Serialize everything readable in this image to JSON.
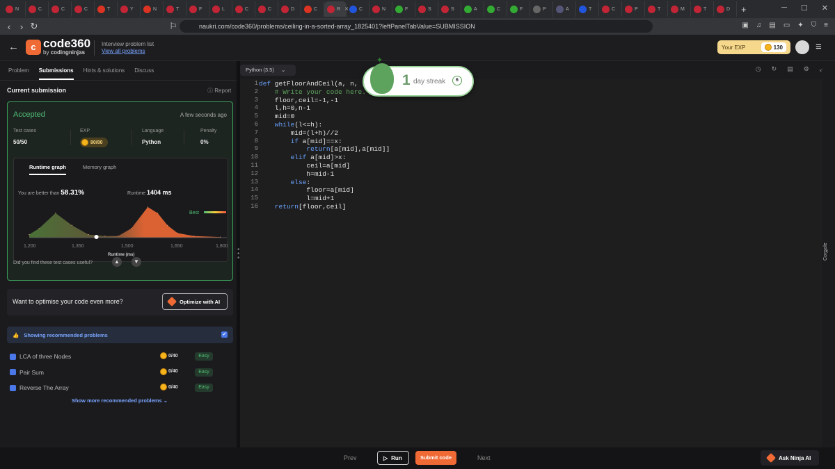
{
  "browser": {
    "tabs": [
      "N",
      "C",
      "C",
      "C",
      "T",
      "Y",
      "N",
      "T",
      "F",
      "L",
      "C",
      "C",
      "D",
      "C",
      "R",
      "C",
      "N",
      "F",
      "S",
      "S",
      "A",
      "C",
      "F",
      "P",
      "A",
      "T",
      "C",
      "P",
      "T",
      "M",
      "T",
      "D"
    ],
    "close_glyph": "✕",
    "new_tab": "+",
    "url": "naukri.com/code360/problems/ceiling-in-a-sorted-array_1825401?leftPanelTabValue=SUBMISSION"
  },
  "header": {
    "logo_mark": "c",
    "logo": "code360",
    "logo_sub_prefix": "by",
    "logo_sub": "codingninjas",
    "problem_list_label": "Interview problem list",
    "view_all": "View all problems",
    "exp_label": "Your EXP",
    "exp_value": "130"
  },
  "left": {
    "tabs": [
      "Problem",
      "Submissions",
      "Hints & solutions",
      "Discuss"
    ],
    "current_submission": "Current submission",
    "report": "Report",
    "status": "Accepted",
    "time_ago": "A few seconds ago",
    "stats": {
      "test_cases_label": "Test cases",
      "test_cases_value": "50/50",
      "exp_label": "EXP",
      "exp_value": "80/80",
      "language_label": "Language",
      "language_value": "Python",
      "penalty_label": "Penalty",
      "penalty_value": "0%"
    },
    "graph_tabs": [
      "Runtime graph",
      "Memory graph"
    ],
    "better_than_label": "You are better than",
    "better_than_value": "58.31%",
    "runtime_label": "Runtime",
    "runtime_value": "1404 ms",
    "legend_best": "Best",
    "x_ticks": [
      "1,200",
      "1,350",
      "1,500",
      "1,650",
      "1,800"
    ],
    "x_label": "Runtime (ms)",
    "useful_question": "Did you find these test cases useful?",
    "optimise_question": "Want to optimise your code even more?",
    "optimize_button": "Optimize with AI",
    "recommended_label": "Showing recommended problems",
    "problems": [
      {
        "name": "LCA of three Nodes",
        "exp": "0/40",
        "difficulty": "Easy"
      },
      {
        "name": "Pair Sum",
        "exp": "0/40",
        "difficulty": "Easy"
      },
      {
        "name": "Reverse The Array",
        "exp": "0/40",
        "difficulty": "Easy"
      }
    ],
    "show_more": "Show more recommended problems"
  },
  "chart_data": {
    "type": "area",
    "title": "",
    "xlabel": "Runtime (ms)",
    "ylabel": "",
    "xlim": [
      1200,
      1800
    ],
    "x_ticks": [
      1200,
      1350,
      1500,
      1650,
      1800
    ],
    "series": [
      {
        "name": "distribution",
        "x": [
          1200,
          1230,
          1280,
          1330,
          1380,
          1430,
          1470,
          1510,
          1560,
          1590,
          1620,
          1650,
          1700,
          1780
        ],
        "values": [
          0.1,
          0.3,
          0.8,
          0.4,
          0.1,
          0.05,
          0.05,
          0.3,
          1.0,
          0.8,
          0.4,
          0.15,
          0.05,
          0.02
        ]
      }
    ],
    "marker": {
      "x": 1404
    },
    "grid": false
  },
  "editor": {
    "language": "Python (3.5)",
    "code_lines": [
      [
        "kw",
        "def",
        " getFloorAndCeil(a, n, x):"
      ],
      [
        "cm",
        "    # Write your code here."
      ],
      [
        "",
        "    floor,ceil=-1,-1"
      ],
      [
        "",
        "    l,h=0,n-1"
      ],
      [
        "",
        "    mid=0"
      ],
      [
        "kw",
        "    while",
        "(l<=h):"
      ],
      [
        "",
        "        mid=(l+h)//2"
      ],
      [
        "kw",
        "        if",
        " a[mid]==x:"
      ],
      [
        "kw",
        "            return",
        "[a[mid],a[mid]]"
      ],
      [
        "kw",
        "        elif",
        " a[mid]>x:"
      ],
      [
        "",
        "            ceil=a[mid]"
      ],
      [
        "",
        "            h=mid-1"
      ],
      [
        "kw",
        "        else",
        ":"
      ],
      [
        "",
        "            floor=a[mid]"
      ],
      [
        "",
        "            l=mid+1"
      ],
      [
        "kw",
        "    return",
        "[floor,ceil]"
      ]
    ]
  },
  "streak": {
    "number": "1",
    "label": "day streak",
    "badge": "6"
  },
  "console_label": "Console",
  "footer": {
    "prev": "Prev",
    "run": "Run",
    "submit": "Submit code",
    "next": "Next",
    "ask_ai": "Ask Ninja AI"
  },
  "colors": {
    "accent": "#f06a35",
    "accepted": "#52c27a",
    "link": "#7aa6ff"
  }
}
